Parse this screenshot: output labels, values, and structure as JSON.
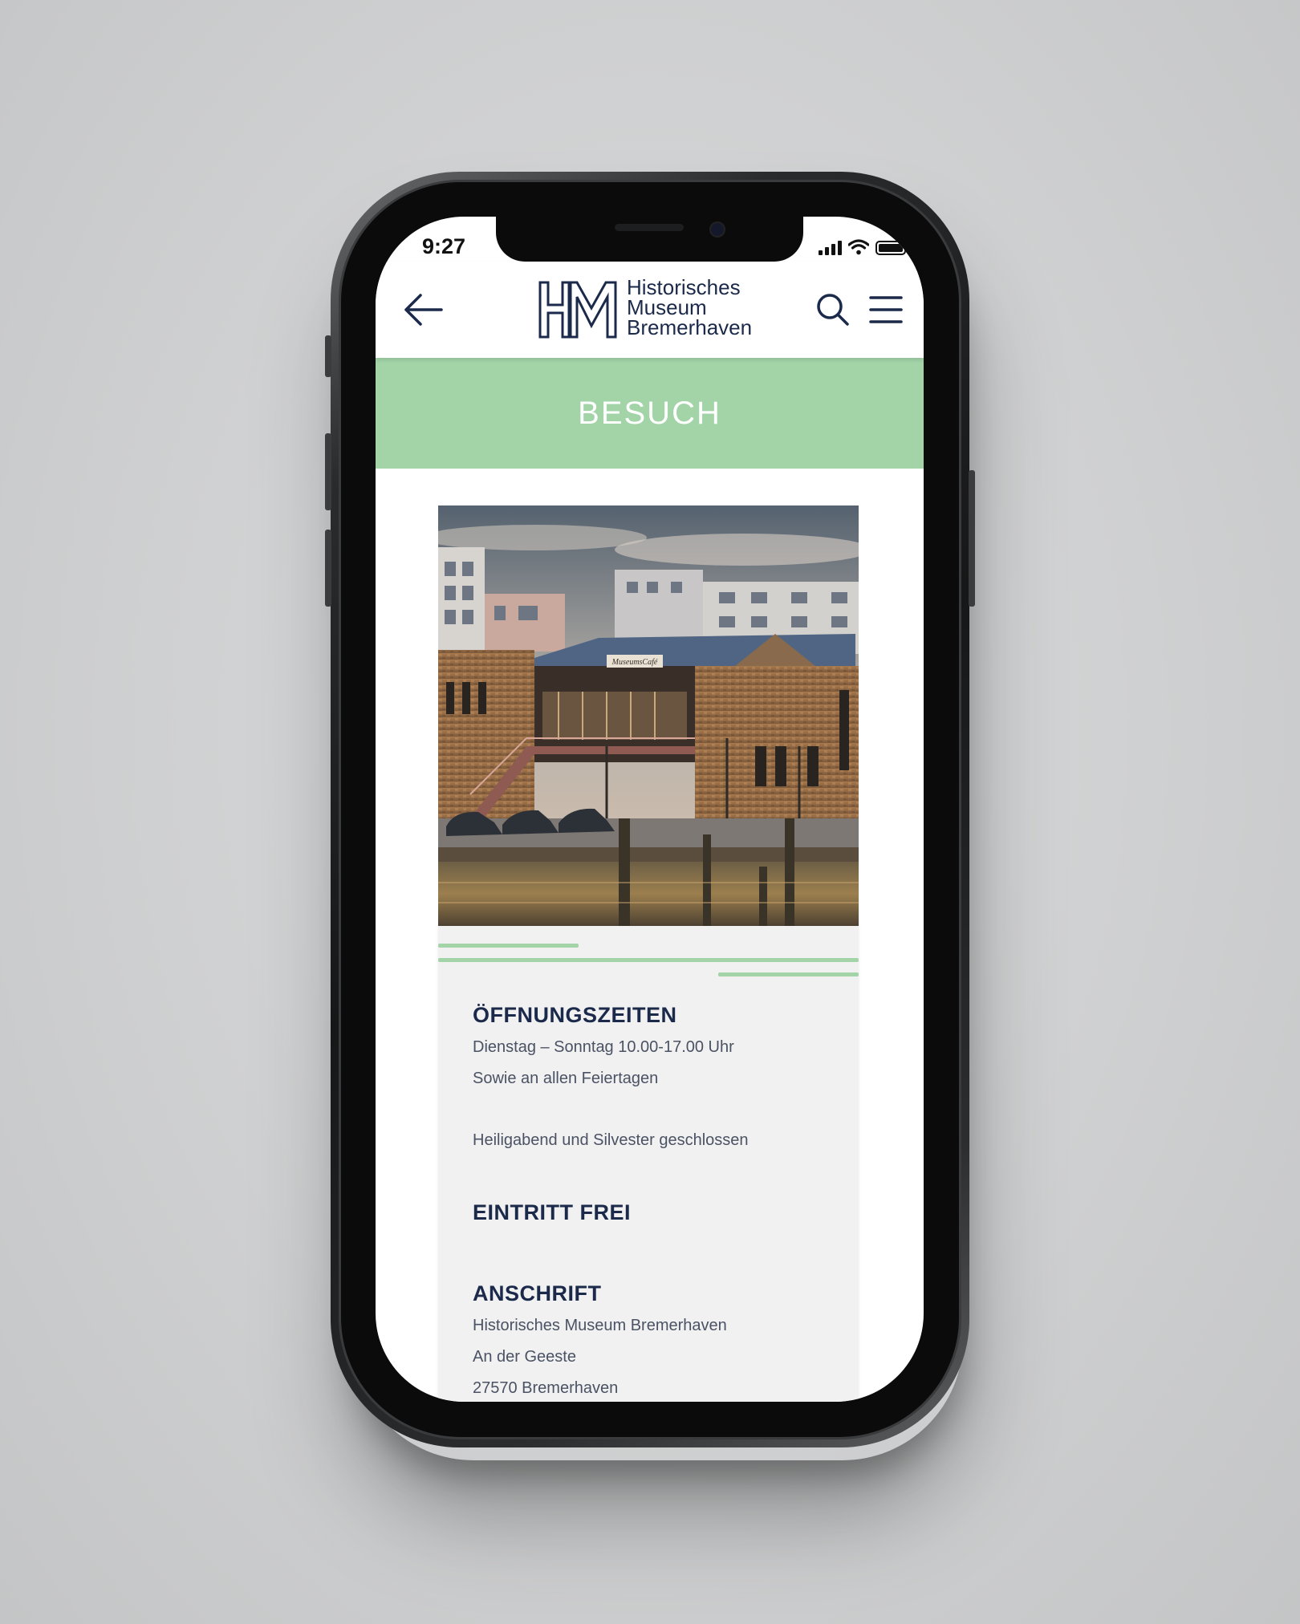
{
  "status_bar": {
    "time": "9:27"
  },
  "header": {
    "logo_lines": [
      "Historisches",
      "Museum",
      "Bremerhaven"
    ],
    "logo_mark_letters": "HM"
  },
  "banner": {
    "title": "BESUCH"
  },
  "photo": {
    "sign_text": "MuseumsCafé"
  },
  "opening_hours": {
    "heading": "ÖFFNUNGSZEITEN",
    "line1": "Dienstag – Sonntag  10.00-17.00 Uhr",
    "line2": "Sowie an allen Feiertagen",
    "line3": "Heiligabend und Silvester geschlossen"
  },
  "admission": {
    "heading": "EINTRITT FREI"
  },
  "address": {
    "heading": "ANSCHRIFT",
    "line1": "Historisches Museum Bremerhaven",
    "line2": "An der Geeste",
    "line3": "27570 Bremerhaven"
  },
  "colors": {
    "accent_green": "#a3d4a8",
    "navy": "#1b2a4a",
    "card_bg": "#f1f1f2"
  },
  "icons": {
    "back": "arrow-left-icon",
    "search": "search-icon",
    "menu": "hamburger-menu-icon"
  }
}
